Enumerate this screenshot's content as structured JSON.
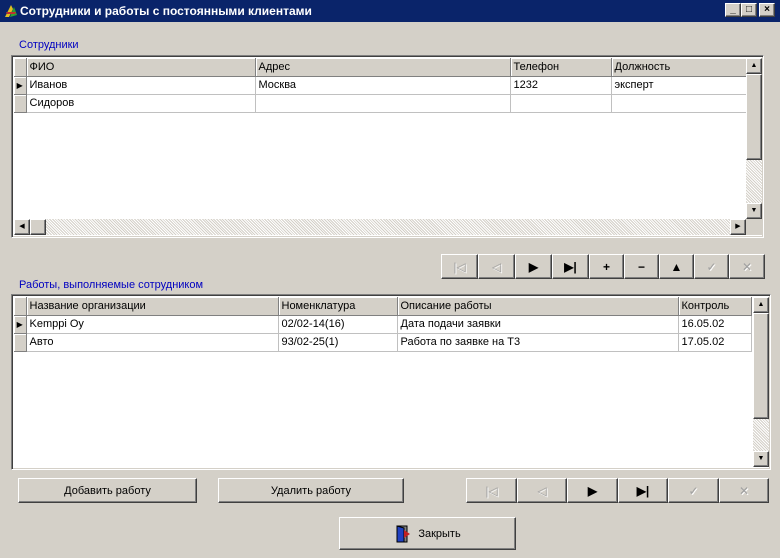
{
  "window": {
    "title": "Сотрудники и работы с постоянными клиентами",
    "minimize": "_",
    "maximize": "□",
    "close": "×"
  },
  "employees": {
    "label": "Сотрудники",
    "columns": [
      "ФИО",
      "Адрес",
      "Телефон",
      "Должность"
    ],
    "rows": [
      {
        "fio": "Иванов",
        "address": "Москва",
        "phone": "1232",
        "position": "эксперт",
        "current": true
      },
      {
        "fio": "Сидоров",
        "address": "",
        "phone": "",
        "position": "",
        "current": false
      }
    ]
  },
  "employee_nav": {
    "buttons": [
      {
        "name": "first-record-button",
        "glyph": "|◁",
        "enabled": false
      },
      {
        "name": "prior-record-button",
        "glyph": "◁",
        "enabled": false
      },
      {
        "name": "next-record-button",
        "glyph": "▶",
        "enabled": true
      },
      {
        "name": "last-record-button",
        "glyph": "▶|",
        "enabled": true
      },
      {
        "name": "insert-record-button",
        "glyph": "+",
        "enabled": true
      },
      {
        "name": "delete-record-button",
        "glyph": "−",
        "enabled": true
      },
      {
        "name": "edit-record-button",
        "glyph": "▲",
        "enabled": true
      },
      {
        "name": "post-edit-button",
        "glyph": "✓",
        "enabled": false
      },
      {
        "name": "cancel-edit-button",
        "glyph": "✕",
        "enabled": false
      }
    ]
  },
  "works": {
    "label": "Работы, выполняемые сотрудником",
    "columns": [
      "Название организации",
      "Номенклатура",
      "Описание работы",
      "Контроль"
    ],
    "rows": [
      {
        "org": "Kemppi Oy",
        "nomen": "02/02-14(16)",
        "desc": "Дата подачи заявки",
        "control": "16.05.02",
        "current": true
      },
      {
        "org": "Авто",
        "nomen": "93/02-25(1)",
        "desc": "Работа по заявке на Т3",
        "control": "17.05.02",
        "current": false
      }
    ]
  },
  "works_nav": {
    "buttons": [
      {
        "name": "first-record-button",
        "glyph": "|◁",
        "enabled": false
      },
      {
        "name": "prior-record-button",
        "glyph": "◁",
        "enabled": false
      },
      {
        "name": "next-record-button",
        "glyph": "▶",
        "enabled": true
      },
      {
        "name": "last-record-button",
        "glyph": "▶|",
        "enabled": true
      },
      {
        "name": "post-edit-button",
        "glyph": "✓",
        "enabled": false
      },
      {
        "name": "cancel-edit-button",
        "glyph": "✕",
        "enabled": false
      }
    ]
  },
  "actions": {
    "add_work": "Добавить работу",
    "delete_work": "Удалить работу",
    "close": "Закрыть"
  },
  "colors": {
    "titlebar": "#0a246a",
    "section_label": "#0000c0",
    "window_bg": "#d4d0c8"
  }
}
